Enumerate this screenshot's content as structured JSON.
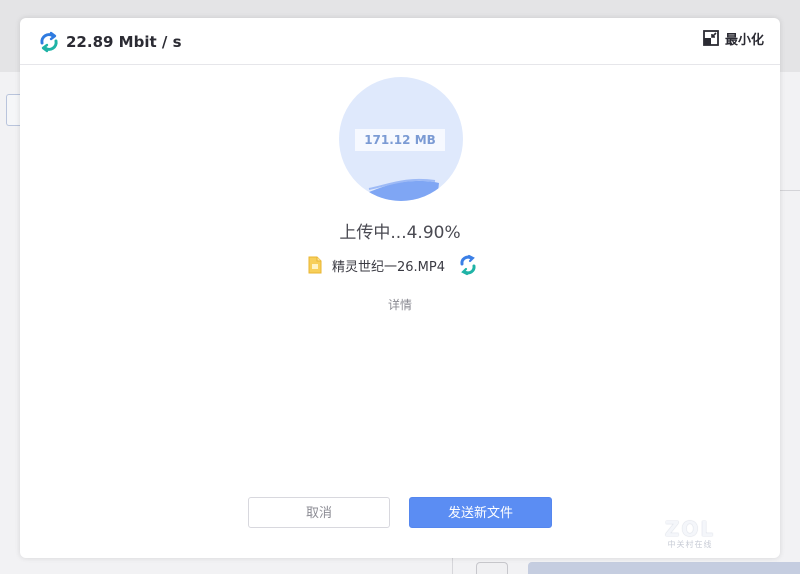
{
  "dialog": {
    "speed": "22.89 Mbit / s",
    "minimize_label": "最小化",
    "file_size": "171.12 MB",
    "progress_percent": 4.9,
    "status": "上传中...4.90%",
    "file_name": "精灵世纪一26.MP4",
    "details_label": "详情",
    "cancel_label": "取消",
    "send_label": "发送新文件"
  },
  "watermark": {
    "main": "ZOL",
    "sub": "中关村在线"
  },
  "colors": {
    "accent": "#5b8df3",
    "circle_fill": "#dfe9fc",
    "wave": "#7fa6f4",
    "file_icon": "#f5c242"
  }
}
